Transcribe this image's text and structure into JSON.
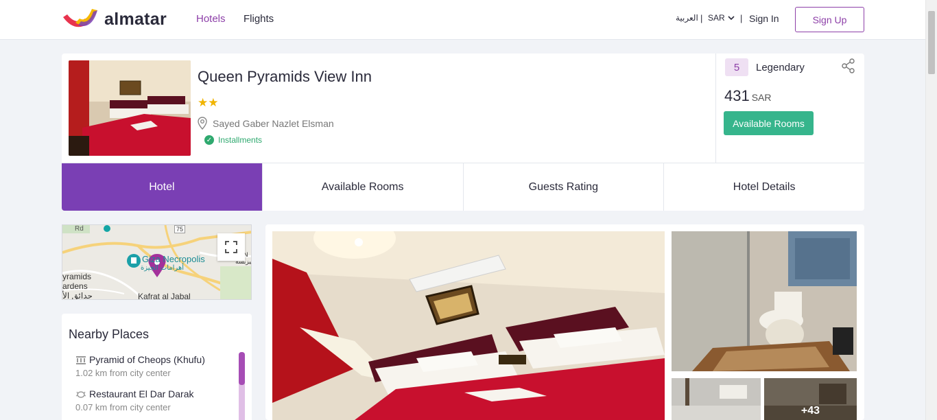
{
  "header": {
    "brand": "almatar",
    "nav": {
      "hotels": "Hotels",
      "flights": "Flights"
    },
    "language": "العربية",
    "currency": "SAR",
    "separator": "|",
    "sign_in": "Sign In",
    "sign_up": "Sign Up",
    "colors": {
      "accent": "#8d3fa8",
      "green": "#36b58c"
    }
  },
  "hotel": {
    "name": "Queen Pyramids View Inn",
    "stars": "★★",
    "star_count": 2,
    "address": "Sayed Gaber Nazlet Elsman",
    "installments": "Installments",
    "rating_score": "5",
    "rating_label": "Legendary",
    "price": "431",
    "price_currency": "SAR",
    "available_rooms_button": "Available Rooms"
  },
  "tabs": [
    "Hotel",
    "Available Rooms",
    "Guests Rating",
    "Hotel Details"
  ],
  "map": {
    "labels": {
      "road": "Rd",
      "route": "75",
      "giza": "Giza Necropolis",
      "giza_ar": "أهرامات الجيزة",
      "pyramids1": "yramids",
      "pyramids2": "ardens",
      "ar_small": "حدائق الأ",
      "kafrat": "Kafrat al Jabal",
      "ar_edge": "جيزبسة",
      "edge_en": "EN"
    }
  },
  "nearby": {
    "title": "Nearby Places",
    "places": [
      {
        "name": "Pyramid of Cheops (Khufu)",
        "distance": "1.02 km from city center",
        "icon": "landmark-icon"
      },
      {
        "name": "Restaurant El Dar Darak",
        "distance": "0.07 km from city center",
        "icon": "restaurant-icon"
      }
    ]
  },
  "gallery": {
    "more_count": "+43"
  }
}
